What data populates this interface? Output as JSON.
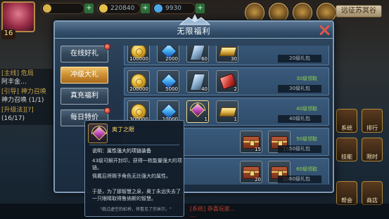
{
  "hud": {
    "resource_1": "",
    "resource_2": "220840",
    "resource_3": "9930",
    "top_right_button": "远征苏冥谷",
    "level": "16"
  },
  "left_panel": {
    "lines": [
      "[主线] 危局",
      "阿丰金…",
      "[引导] 神力召唤",
      "神力召唤 (1/1)",
      "[升级法][?]",
      "(16/17)"
    ]
  },
  "right_buttons": [
    "系统",
    "排行",
    "技能",
    "限时",
    "帮会",
    "商店",
    "帮会"
  ],
  "bottom_chat": [
    "[系统] 恭喜玩家...",
    "…"
  ],
  "dialog": {
    "title": "无限福利",
    "tabs": [
      {
        "label": "在线好礼",
        "active": false,
        "dot": true
      },
      {
        "label": "冲级大礼",
        "active": true,
        "dot": false
      },
      {
        "label": "真充福利",
        "active": false,
        "dot": false
      },
      {
        "label": "每日特价",
        "active": false,
        "dot": true
      }
    ],
    "rows": [
      {
        "items": [
          {
            "icon": "coin-icon",
            "qty": "100000"
          },
          {
            "icon": "gem-blue-icon",
            "qty": "2000"
          },
          {
            "icon": "crystal-icon",
            "qty": "60"
          },
          {
            "icon": "gold-bar-icon",
            "qty": "30"
          }
        ],
        "status": "",
        "label": "20级礼包"
      },
      {
        "items": [
          {
            "icon": "coin-icon",
            "qty": "200000"
          },
          {
            "icon": "gem-blue-icon",
            "qty": "5000"
          },
          {
            "icon": "crystal-icon",
            "qty": "40"
          },
          {
            "icon": "gem-red-icon",
            "qty": "2"
          }
        ],
        "status": "30级领取",
        "label": "30级礼包"
      },
      {
        "items": [
          {
            "icon": "coin-icon",
            "qty": "300000"
          },
          {
            "icon": "gem-blue-icon",
            "qty": "10000"
          },
          {
            "icon": "amulet-icon",
            "qty": "1"
          },
          {
            "icon": "gold-bar-icon",
            "qty": "1"
          }
        ],
        "status": "40级领取",
        "label": "40级礼包"
      },
      {
        "items": [
          {
            "icon": "chest-icon",
            "qty": "15"
          },
          {
            "icon": "chest-icon",
            "qty": "15"
          }
        ],
        "status": "50级领取",
        "label": "50级礼包"
      },
      {
        "items": [
          {
            "icon": "chest-icon",
            "qty": "20"
          },
          {
            "icon": "chest-icon",
            "qty": "20"
          }
        ],
        "status": "60级领取",
        "label": "60级礼包"
      }
    ]
  },
  "tooltip": {
    "name": "奥丁之眼",
    "desc": "说明：属性强大的项链装备",
    "para1": "43级可解开封印，获得一枚能量强大的项链。",
    "para2": "佩戴后将赐予角色无比强大的属性。",
    "para3": "于是，为了那智慧之泉，奥丁永远失去了一只眼睛取得鲁纳斯的智慧。",
    "quote": "\"肩过虚空的虹桥，将看见了宗米尔。\""
  },
  "colors": {
    "accent_gold": "#cf9236",
    "status_green": "#8fd24b",
    "close_red": "#e0564b"
  }
}
